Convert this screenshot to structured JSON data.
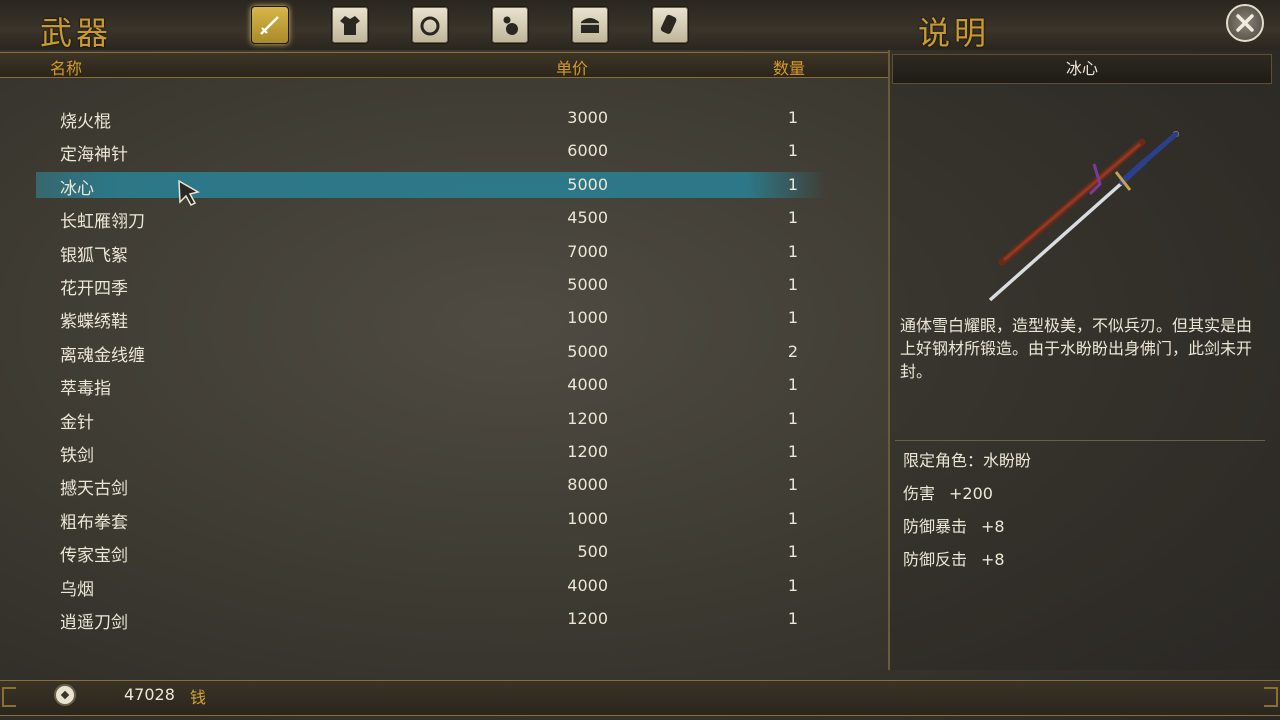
{
  "header": {
    "title_left": "武器",
    "title_right": "说明",
    "tabs": [
      {
        "icon": "sword-icon",
        "active": true
      },
      {
        "icon": "robe-icon",
        "active": false
      },
      {
        "icon": "ring-icon",
        "active": false
      },
      {
        "icon": "gourd-icon",
        "active": false
      },
      {
        "icon": "chest-icon",
        "active": false
      },
      {
        "icon": "scroll-icon",
        "active": false
      }
    ]
  },
  "list": {
    "col_name": "名称",
    "col_price": "单价",
    "col_qty": "数量",
    "items": [
      {
        "name": "烧火棍",
        "price": "3000",
        "qty": "1"
      },
      {
        "name": "定海神针",
        "price": "6000",
        "qty": "1"
      },
      {
        "name": "冰心",
        "price": "5000",
        "qty": "1"
      },
      {
        "name": "长虹雁翎刀",
        "price": "4500",
        "qty": "1"
      },
      {
        "name": "银狐飞絮",
        "price": "7000",
        "qty": "1"
      },
      {
        "name": "花开四季",
        "price": "5000",
        "qty": "1"
      },
      {
        "name": "紫蝶绣鞋",
        "price": "1000",
        "qty": "1"
      },
      {
        "name": "离魂金线缠",
        "price": "5000",
        "qty": "2"
      },
      {
        "name": "萃毒指",
        "price": "4000",
        "qty": "1"
      },
      {
        "name": "金针",
        "price": "1200",
        "qty": "1"
      },
      {
        "name": "铁剑",
        "price": "1200",
        "qty": "1"
      },
      {
        "name": "撼天古剑",
        "price": "8000",
        "qty": "1"
      },
      {
        "name": "粗布拳套",
        "price": "1000",
        "qty": "1"
      },
      {
        "name": "传家宝剑",
        "price": "500",
        "qty": "1"
      },
      {
        "name": "乌烟",
        "price": "4000",
        "qty": "1"
      },
      {
        "name": "逍遥刀剑",
        "price": "1200",
        "qty": "1"
      }
    ],
    "selected_index": 2
  },
  "detail": {
    "name": "冰心",
    "description": "通体雪白耀眼，造型极美，不似兵刃。但其实是由上好钢材所锻造。由于水盼盼出身佛门，此剑未开封。",
    "restriction": "限定角色：水盼盼",
    "stats": [
      {
        "label": "伤害",
        "value": "+200"
      },
      {
        "label": "防御暴击",
        "value": "+8"
      },
      {
        "label": "防御反击",
        "value": "+8"
      }
    ]
  },
  "footer": {
    "money": "47028",
    "currency": "钱"
  },
  "colors": {
    "gold": "#c99a2e",
    "selection": "#2f8a9c"
  }
}
